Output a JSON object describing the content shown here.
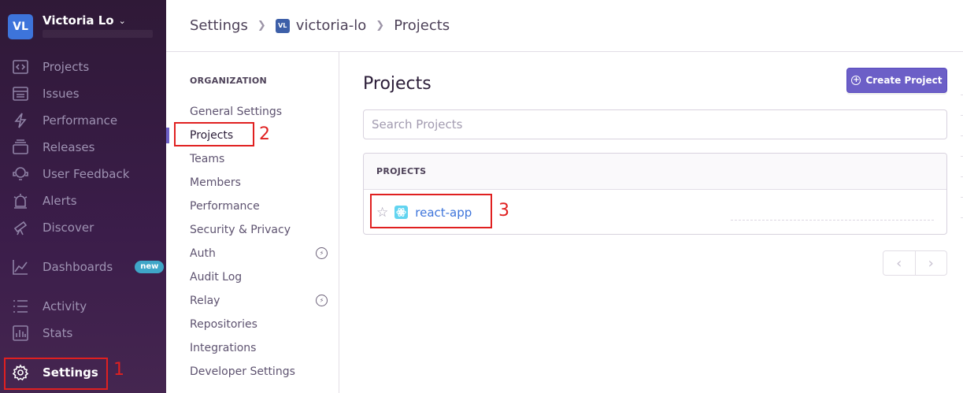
{
  "org": {
    "avatar": "VL",
    "name": "Victoria Lo"
  },
  "sidebar": {
    "items": [
      {
        "label": "Projects",
        "icon": "projects-icon"
      },
      {
        "label": "Issues",
        "icon": "issues-icon"
      },
      {
        "label": "Performance",
        "icon": "lightning-icon"
      },
      {
        "label": "Releases",
        "icon": "releases-icon"
      },
      {
        "label": "User Feedback",
        "icon": "feedback-icon"
      },
      {
        "label": "Alerts",
        "icon": "siren-icon"
      },
      {
        "label": "Discover",
        "icon": "telescope-icon"
      },
      {
        "label": "Dashboards",
        "icon": "graph-icon",
        "badge": "new"
      },
      {
        "label": "Activity",
        "icon": "list-icon"
      },
      {
        "label": "Stats",
        "icon": "stats-icon"
      },
      {
        "label": "Settings",
        "icon": "gear-icon",
        "active": true
      }
    ]
  },
  "header": {
    "breadcrumb": [
      "Settings",
      "victoria-lo",
      "Projects"
    ],
    "org_badge": "VL"
  },
  "subnav": {
    "heading": "ORGANIZATION",
    "items": [
      {
        "label": "General Settings"
      },
      {
        "label": "Projects",
        "active": true
      },
      {
        "label": "Teams"
      },
      {
        "label": "Members"
      },
      {
        "label": "Performance"
      },
      {
        "label": "Security & Privacy"
      },
      {
        "label": "Auth",
        "icon": "lightning-circle-icon"
      },
      {
        "label": "Audit Log"
      },
      {
        "label": "Relay",
        "icon": "lightning-circle-icon"
      },
      {
        "label": "Repositories"
      },
      {
        "label": "Integrations"
      },
      {
        "label": "Developer Settings"
      }
    ]
  },
  "main": {
    "title": "Projects",
    "create_button": "Create Project",
    "search_placeholder": "Search Projects",
    "panel_heading": "PROJECTS",
    "projects": [
      {
        "name": "react-app",
        "platform": "react-icon",
        "starred": false
      }
    ],
    "pager": {
      "prev": "‹",
      "next": "›"
    }
  },
  "annotations": {
    "one": "1",
    "two": "2",
    "three": "3"
  },
  "colors": {
    "accent": "#6c5fc7",
    "link": "#3d74db",
    "annotation": "#e02020",
    "sidebar": "#3b1d4a"
  }
}
